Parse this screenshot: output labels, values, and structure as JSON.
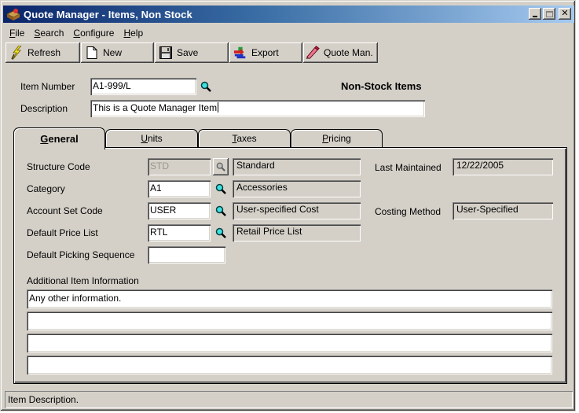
{
  "window": {
    "title": "Quote Manager - Items, Non Stock",
    "controls": {
      "minimize": "_",
      "maximize": "□",
      "close": "✕"
    }
  },
  "menu": [
    {
      "label": "File",
      "accel": "F",
      "rest": "ile"
    },
    {
      "label": "Search",
      "accel": "S",
      "rest": "earch"
    },
    {
      "label": "Configure",
      "accel": "C",
      "rest": "onfigure"
    },
    {
      "label": "Help",
      "accel": "H",
      "rest": "elp"
    }
  ],
  "toolbar": {
    "refresh": {
      "label": "Refresh",
      "icon": "lightning-icon"
    },
    "new": {
      "label": "New",
      "icon": "new-document-icon"
    },
    "save": {
      "label": "Save",
      "icon": "floppy-disk-icon"
    },
    "export": {
      "label": "Export",
      "icon": "export-icon"
    },
    "quote": {
      "label": "Quote Man.",
      "icon": "pencil-icon"
    }
  },
  "header": {
    "item_number_label": "Item Number",
    "item_number_value": "A1-999/L",
    "description_label": "Description",
    "description_value": "This is a Quote Manager Item",
    "heading": "Non-Stock Items"
  },
  "tabs": [
    {
      "label": "General",
      "accel": "G",
      "rest": "eneral",
      "active": true
    },
    {
      "label": "Units",
      "accel": "U",
      "rest": "nits",
      "active": false
    },
    {
      "label": "Taxes",
      "accel": "T",
      "rest": "axes",
      "active": false
    },
    {
      "label": "Pricing",
      "accel": "P",
      "rest": "ricing",
      "active": false
    }
  ],
  "general": {
    "structure_code": {
      "label": "Structure Code",
      "value": "STD",
      "desc": "Standard"
    },
    "category": {
      "label": "Category",
      "value": "A1",
      "desc": "Accessories"
    },
    "account_set": {
      "label": "Account Set Code",
      "value": "USER",
      "desc": "User-specified Cost"
    },
    "price_list": {
      "label": "Default Price List",
      "value": "RTL",
      "desc": "Retail Price List"
    },
    "picking_sequence": {
      "label": "Default Picking Sequence",
      "value": ""
    },
    "last_maintained": {
      "label": "Last Maintained",
      "value": "12/22/2005"
    },
    "costing_method": {
      "label": "Costing Method",
      "value": "User-Specified"
    },
    "additional_info": {
      "label": "Additional Item Information",
      "lines": [
        "Any other information.",
        "",
        "",
        ""
      ]
    }
  },
  "status": {
    "text": "Item Description."
  },
  "colors": {
    "face": "#d4d0c8",
    "title_start": "#0a246a",
    "title_end": "#a6caf0",
    "finder": "#00a0a0"
  }
}
